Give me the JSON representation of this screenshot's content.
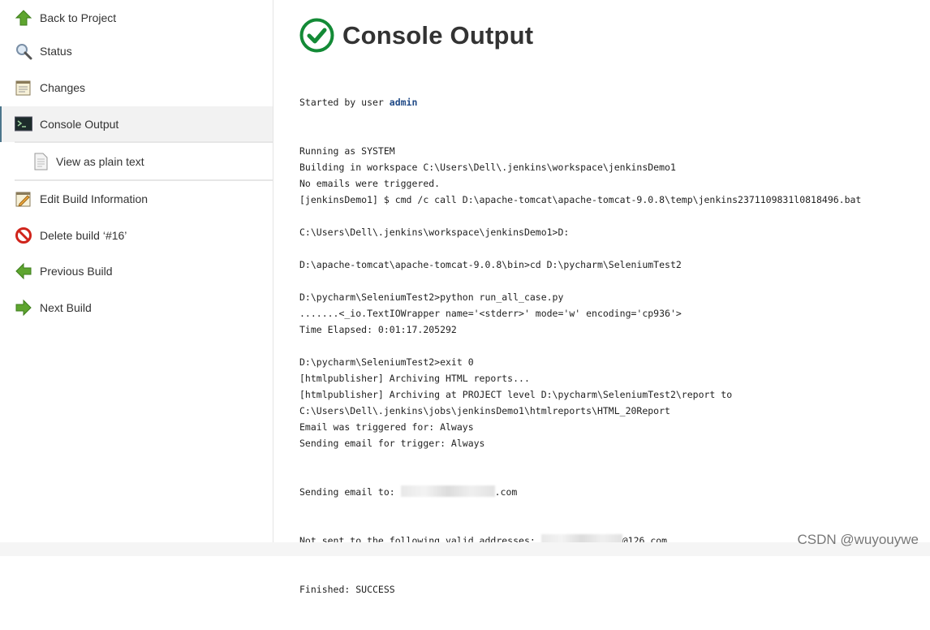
{
  "sidebar": {
    "items": [
      {
        "label": "Back to Project",
        "icon": "up-arrow-icon"
      },
      {
        "label": "Status",
        "icon": "magnifier-icon"
      },
      {
        "label": "Changes",
        "icon": "notepad-icon"
      },
      {
        "label": "Console Output",
        "icon": "terminal-icon",
        "active": true
      },
      {
        "label": "View as plain text",
        "icon": "document-icon"
      },
      {
        "label": "Edit Build Information",
        "icon": "edit-notepad-icon"
      },
      {
        "label": "Delete build ‘#16’",
        "icon": "no-entry-icon"
      },
      {
        "label": "Previous Build",
        "icon": "left-arrow-icon"
      },
      {
        "label": "Next Build",
        "icon": "right-arrow-icon"
      }
    ]
  },
  "main": {
    "title": "Console Output",
    "status_color": "#138a36",
    "console": {
      "started_prefix": "Started by user ",
      "user": "admin",
      "lines_a": [
        "Running as SYSTEM",
        "Building in workspace C:\\Users\\Dell\\.jenkins\\workspace\\jenkinsDemo1",
        "No emails were triggered.",
        "[jenkinsDemo1] $ cmd /c call D:\\apache-tomcat\\apache-tomcat-9.0.8\\temp\\jenkins2371109831l0818496.bat",
        "",
        "C:\\Users\\Dell\\.jenkins\\workspace\\jenkinsDemo1>D:",
        "",
        "D:\\apache-tomcat\\apache-tomcat-9.0.8\\bin>cd D:\\pycharm\\SeleniumTest2",
        "",
        "D:\\pycharm\\SeleniumTest2>python run_all_case.py",
        ".......<_io.TextIOWrapper name='<stderr>' mode='w' encoding='cp936'>",
        "Time Elapsed: 0:01:17.205292",
        "",
        "D:\\pycharm\\SeleniumTest2>exit 0",
        "[htmlpublisher] Archiving HTML reports...",
        "[htmlpublisher] Archiving at PROJECT level D:\\pycharm\\SeleniumTest2\\report to",
        "C:\\Users\\Dell\\.jenkins\\jobs\\jenkinsDemo1\\htmlreports\\HTML_20Report",
        "Email was triggered for: Always",
        "Sending email for trigger: Always"
      ],
      "sending_prefix": "Sending email to: ",
      "sending_suffix": ".com",
      "notsent_prefix": "Not sent to the following valid addresses: ",
      "notsent_suffix": "@126.com",
      "finished": "Finished: SUCCESS"
    }
  },
  "watermark": "CSDN @wuyouywe"
}
